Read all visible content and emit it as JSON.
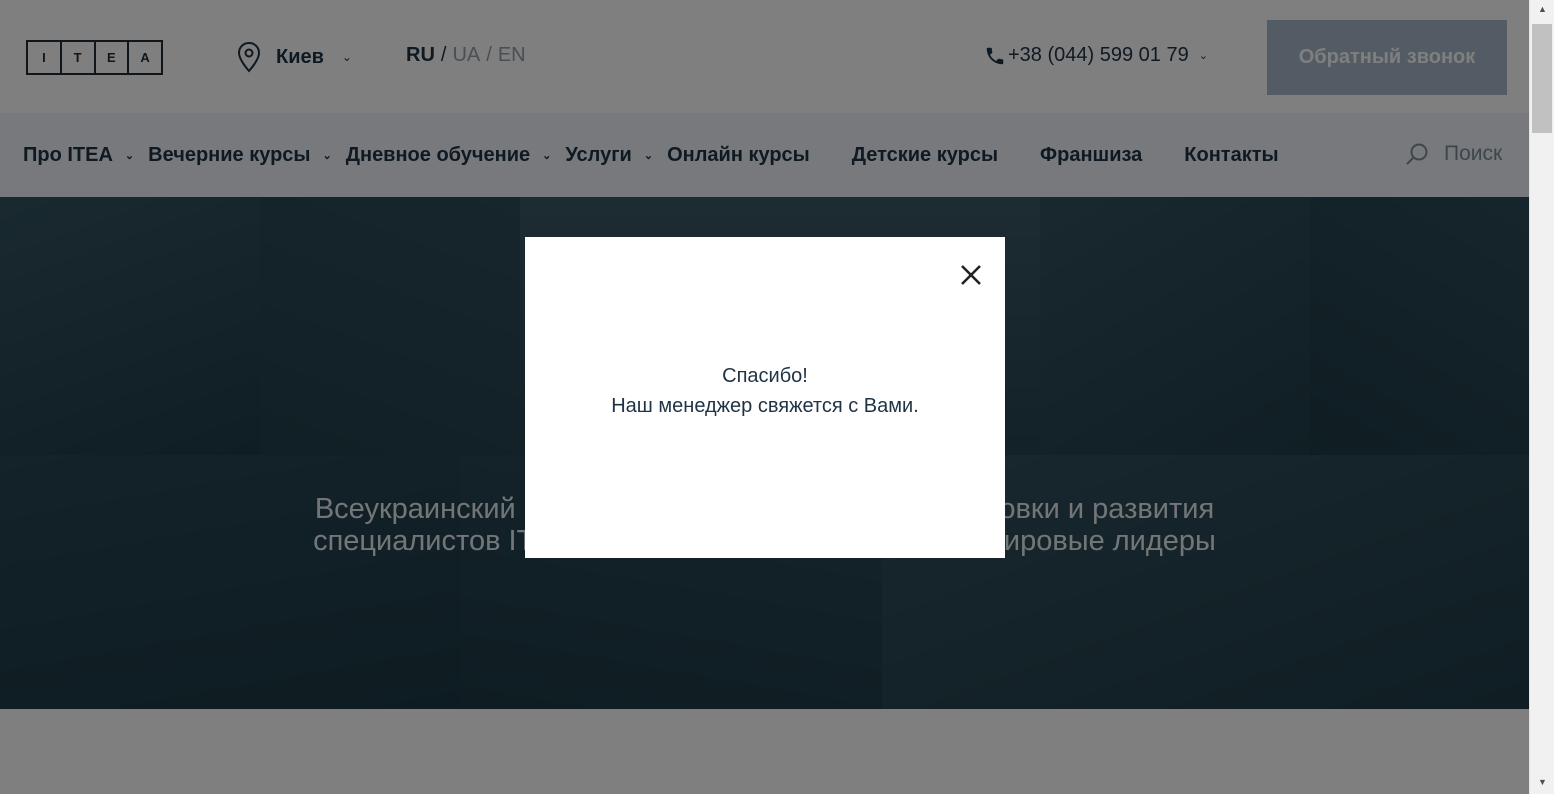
{
  "header": {
    "logo_letters": [
      "I",
      "T",
      "E",
      "A"
    ],
    "city": "Киев",
    "languages": {
      "active": "RU",
      "separator": "/",
      "ua": "UA",
      "en": "EN"
    },
    "phone": "+38 (044) 599 01 79",
    "callback_label": "Обратный звонок"
  },
  "nav": {
    "items": [
      {
        "label": "Про ITEA",
        "has_dropdown": true
      },
      {
        "label": "Вечерние курсы",
        "has_dropdown": true
      },
      {
        "label": "Дневное обучение",
        "has_dropdown": true
      },
      {
        "label": "Услуги",
        "has_dropdown": true
      },
      {
        "label": "Онлайн курсы",
        "has_dropdown": false
      },
      {
        "label": "Детские курсы",
        "has_dropdown": false
      },
      {
        "label": "Франшиза",
        "has_dropdown": false
      },
      {
        "label": "Контакты",
        "has_dropdown": false
      }
    ],
    "search_label": "Поиск"
  },
  "hero": {
    "line1": "Всеукраинский образовательный центр для подготовки и развития",
    "line2": "специалистов IT-индустрии, выводящий страну в мировые лидеры"
  },
  "modal": {
    "line1": "Спасибо!",
    "line2": "Наш менеджер свяжется с Вами."
  },
  "colors": {
    "text_dark": "#1f3344",
    "callback_bg": "#a6b7c8",
    "nav_bg": "#eef3f8",
    "overlay": "rgba(0,0,0,0.5)"
  }
}
